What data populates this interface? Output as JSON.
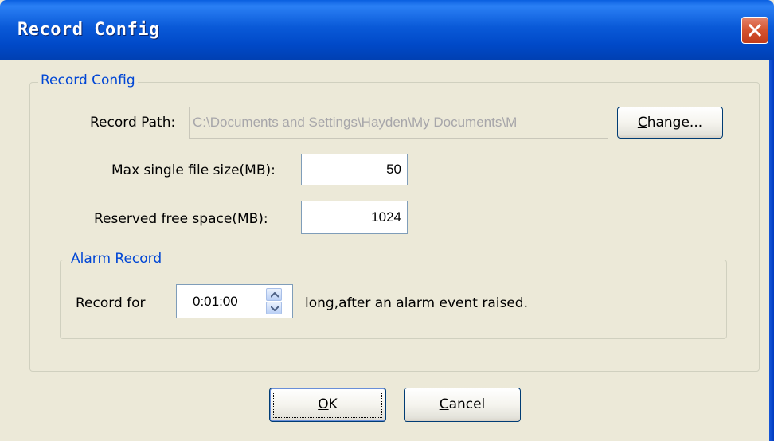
{
  "window": {
    "title": "Record Config"
  },
  "record_config": {
    "legend": "Record Config",
    "record_path_label": "Record Path:",
    "record_path_value": "C:\\Documents and Settings\\Hayden\\My Documents\\M",
    "change_button": {
      "prefix": "",
      "mnemonic": "C",
      "rest": "hange..."
    },
    "max_file_size_label": "Max single file size(MB):",
    "max_file_size_value": "50",
    "reserved_space_label": "Reserved free space(MB):",
    "reserved_space_value": "1024"
  },
  "alarm_record": {
    "legend": "Alarm Record",
    "record_for_label": "Record for",
    "duration_value": "0:01:00",
    "suffix_text": "long,after an alarm event raised."
  },
  "buttons": {
    "ok": {
      "mnemonic": "O",
      "rest": "K"
    },
    "cancel": {
      "mnemonic": "C",
      "rest": "ancel"
    }
  }
}
